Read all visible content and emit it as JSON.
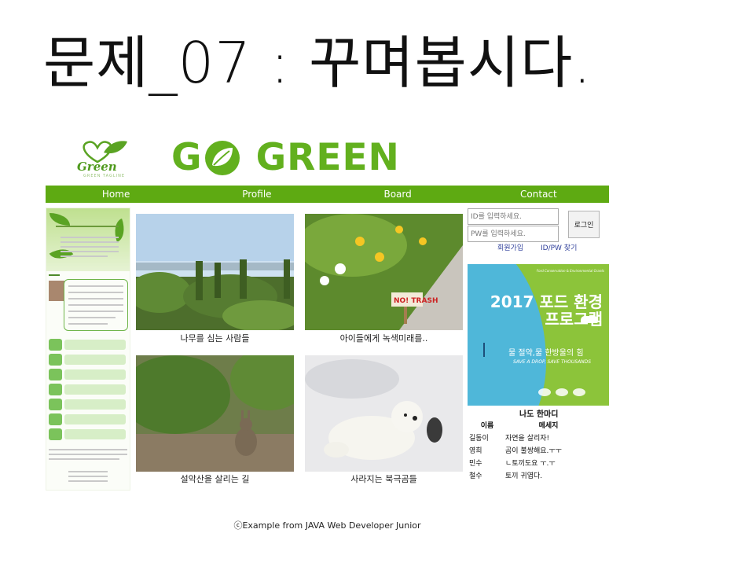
{
  "slide": {
    "title": "문제_07 : 꾸며봅시다."
  },
  "header": {
    "small_logo_text": "Green",
    "small_logo_tagline": "GREEN TAGLINE",
    "big_logo_left": "G",
    "big_logo_right": "GREEN"
  },
  "nav": {
    "items": [
      "Home",
      "Profile",
      "Board",
      "Contact"
    ]
  },
  "photos": [
    {
      "caption": "나무를 심는 사람들"
    },
    {
      "caption": "아이들에게 녹색미래를.."
    },
    {
      "caption": "설악산을 살리는 길"
    },
    {
      "caption": "사라지는 북극곰들"
    }
  ],
  "login": {
    "id_placeholder": "ID를 입력하세요.",
    "pw_placeholder": "PW를 입력하세요.",
    "button_label": "로그인",
    "signup_label": "회원가입",
    "find_label": "ID/PW 찾기"
  },
  "banner": {
    "title_line1": "2017 포드 환경",
    "title_line2": "프로그램",
    "slogan": "물 절약,물 한방울의 힘",
    "slogan_en": "SAVE A DROP, SAVE THOUSANDS",
    "colors": {
      "green": "#8cc43a",
      "water": "#4fb7d9"
    }
  },
  "messages": {
    "title": "나도 한마디",
    "columns": [
      "이름",
      "메세지"
    ],
    "rows": [
      [
        "길동이",
        "자연을 살리자!"
      ],
      [
        "영희",
        "곰이 불쌍해요.ㅜㅜ"
      ],
      [
        "민수",
        "ㄴ토끼도요 ㅜ.ㅜ"
      ],
      [
        "철수",
        "토끼 귀엽다."
      ]
    ]
  },
  "footer": {
    "text": "ⓒExample from JAVA Web Developer Junior"
  },
  "colors": {
    "brand_green": "#62b01e",
    "nav_green": "#5eaa12"
  }
}
